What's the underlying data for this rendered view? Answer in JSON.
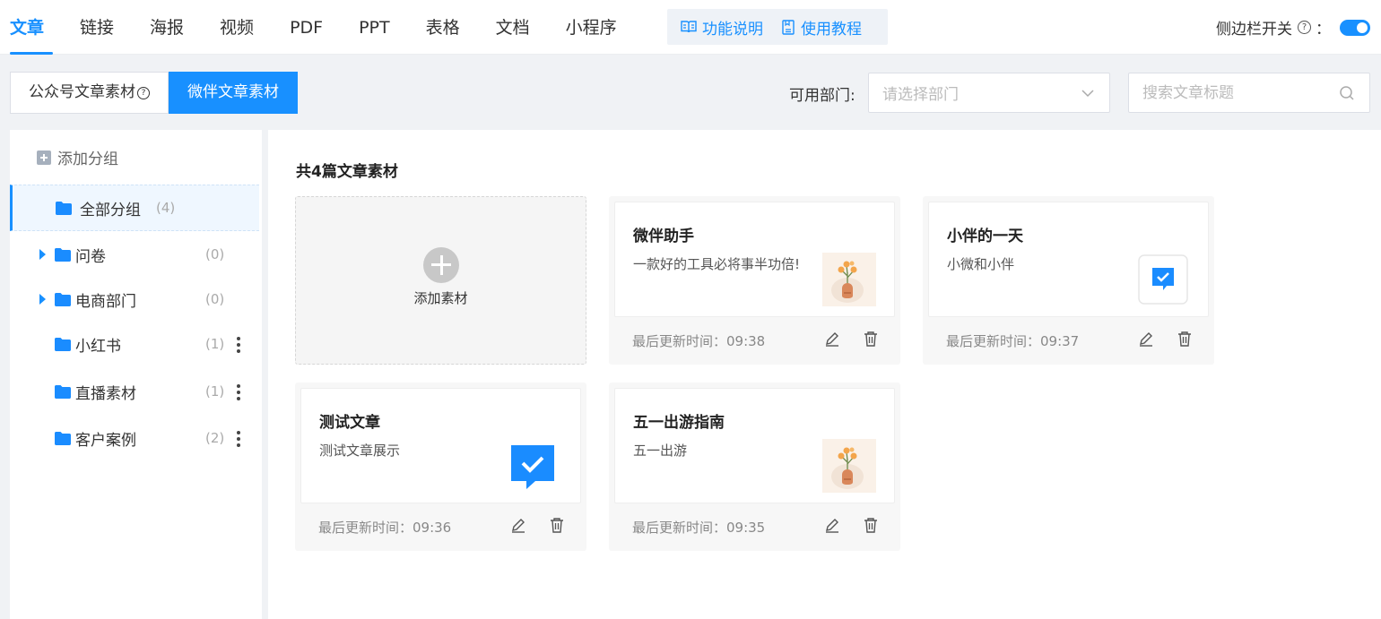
{
  "nav": {
    "tabs": [
      "文章",
      "链接",
      "海报",
      "视频",
      "PDF",
      "PPT",
      "表格",
      "文档",
      "小程序"
    ],
    "active_tab": 0,
    "help_links": [
      {
        "label": "功能说明",
        "icon": "book-open-icon"
      },
      {
        "label": "使用教程",
        "icon": "document-icon"
      }
    ],
    "sidebar_toggle": {
      "label": "侧边栏开关",
      "colon": "：",
      "enabled": true
    }
  },
  "source": {
    "buttons": [
      "公众号文章素材",
      "微伴文章素材"
    ],
    "active": 1
  },
  "filters": {
    "dept_label": "可用部门:",
    "dept_placeholder": "请选择部门",
    "search_placeholder": "搜索文章标题"
  },
  "sidebar": {
    "add_group": "添加分组",
    "groups": [
      {
        "name": "全部分组",
        "count": "(4)",
        "active": true,
        "expandable": false,
        "menu": false
      },
      {
        "name": "问卷",
        "count": "(0)",
        "active": false,
        "expandable": true,
        "menu": false
      },
      {
        "name": "电商部门",
        "count": "(0)",
        "active": false,
        "expandable": true,
        "menu": false
      },
      {
        "name": "小红书",
        "count": "(1)",
        "active": false,
        "expandable": false,
        "menu": true
      },
      {
        "name": "直播素材",
        "count": "(1)",
        "active": false,
        "expandable": false,
        "menu": true
      },
      {
        "name": "客户案例",
        "count": "(2)",
        "active": false,
        "expandable": false,
        "menu": true
      }
    ]
  },
  "main": {
    "count_title": "共4篇文章素材",
    "add_label": "添加素材",
    "cards": [
      {
        "title": "微伴助手",
        "desc": "一款好的工具必将事半功倍!",
        "thumb": "flower-vase-image",
        "updated": "最后更新时间：09:38"
      },
      {
        "title": "小伴的一天",
        "desc": "小微和小伴",
        "thumb": "check-message-icon-small",
        "updated": "最后更新时间：09:37"
      },
      {
        "title": "测试文章",
        "desc": "测试文章展示",
        "thumb": "check-message-icon-large",
        "updated": "最后更新时间：09:36"
      },
      {
        "title": "五一出游指南",
        "desc": "五一出游",
        "thumb": "flower-vase-image",
        "updated": "最后更新时间：09:35"
      }
    ]
  },
  "colors": {
    "accent": "#1890ff",
    "folder": "#1a8cff"
  }
}
